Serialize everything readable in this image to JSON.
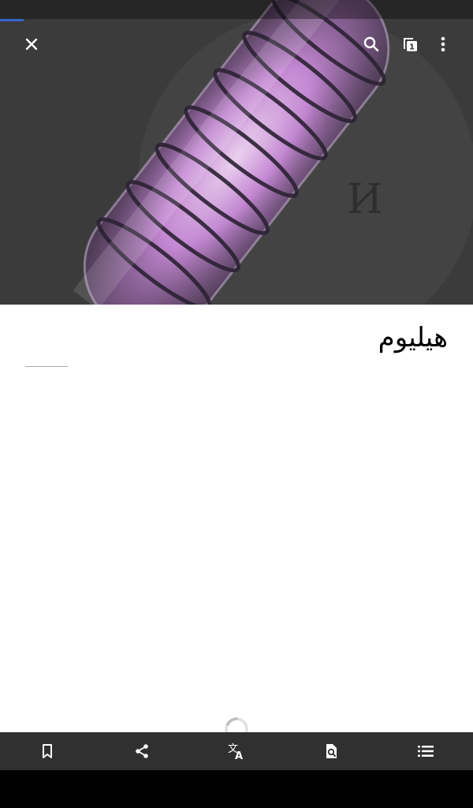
{
  "article": {
    "title": "هيليوم",
    "loading_progress": 0.05
  },
  "app_bar": {
    "close_icon": "close-icon",
    "search_icon": "search-icon",
    "tabs_icon": "tabs-icon",
    "tabs_count": "1",
    "overflow_icon": "more-vert-icon"
  },
  "bottom_bar": {
    "items": [
      {
        "name": "bookmark-icon"
      },
      {
        "name": "share-icon"
      },
      {
        "name": "translate-icon"
      },
      {
        "name": "find-in-page-icon"
      },
      {
        "name": "table-of-contents-icon"
      }
    ]
  },
  "colors": {
    "accent": "#3366cc",
    "bottom_bar": "#303030",
    "hero_bg": "#3b3b3b"
  }
}
